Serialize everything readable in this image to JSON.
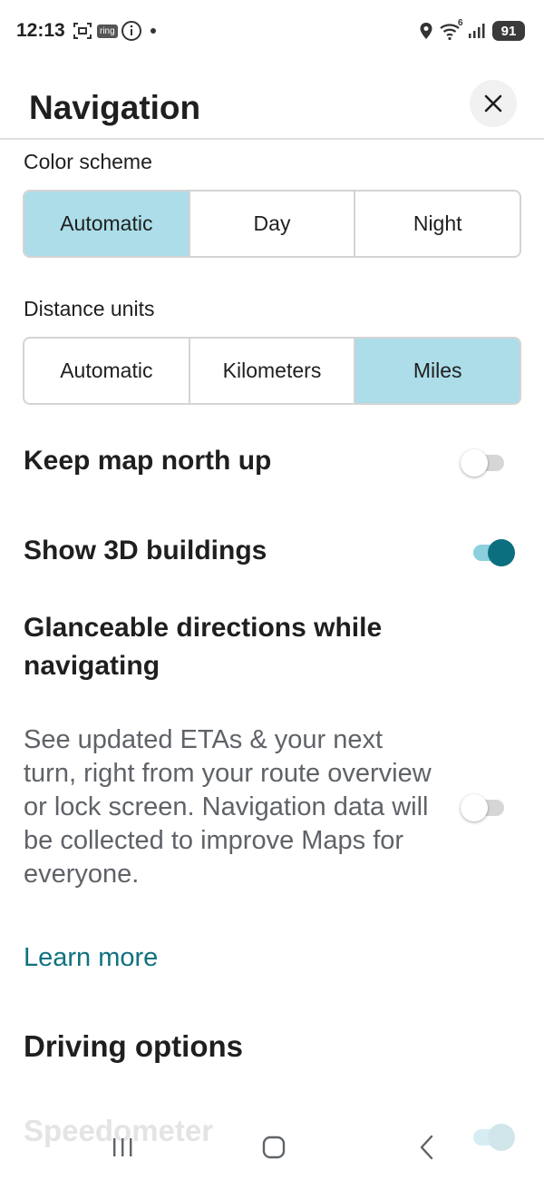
{
  "status_bar": {
    "time": "12:13",
    "ring_label": "ring",
    "network_label": "6",
    "battery": "91",
    "icons": [
      "screenshot-icon",
      "ring-icon",
      "info-icon",
      "dot-icon",
      "location-icon",
      "wifi-icon",
      "signal-icon",
      "battery-icon"
    ]
  },
  "header": {
    "title": "Navigation",
    "close_icon": "close-icon"
  },
  "color_scheme": {
    "label": "Color scheme",
    "options": [
      "Automatic",
      "Day",
      "Night"
    ],
    "selected": "Automatic"
  },
  "distance_units": {
    "label": "Distance units",
    "options": [
      "Automatic",
      "Kilometers",
      "Miles"
    ],
    "selected": "Miles"
  },
  "north_up": {
    "label": "Keep map north up",
    "enabled": false
  },
  "buildings_3d": {
    "label": "Show 3D buildings",
    "enabled": true
  },
  "glanceable": {
    "label": "Glanceable directions while navigating",
    "description": "See updated ETAs & your next turn, right from your route overview or lock screen. Navigation data will be collected to improve Maps for everyone.",
    "enabled": false,
    "learn_more": "Learn more"
  },
  "driving_options": {
    "label": "Driving options"
  },
  "speedometer": {
    "label": "Speedometer",
    "enabled": true
  },
  "nav_bar": {
    "icons": [
      "recent-apps-icon",
      "home-icon",
      "back-icon"
    ]
  },
  "colors": {
    "selected_segment": "#acdde9",
    "toggle_on_thumb": "#0b6f80",
    "toggle_on_track": "#8ccfdd",
    "link": "#0f7280"
  }
}
